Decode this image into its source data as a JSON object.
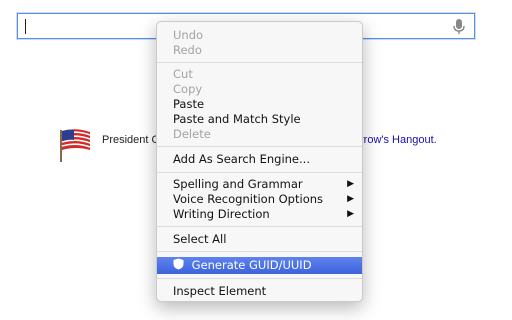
{
  "search": {
    "value": "",
    "icon": "mic-icon"
  },
  "faded_links": "··· ··· ··· ··· ··· ···",
  "doodle": {
    "flag_icon": "us-flag-icon",
    "text": "President O",
    "link": "rrow's Hangout."
  },
  "context_menu": {
    "undo": "Undo",
    "redo": "Redo",
    "cut": "Cut",
    "copy": "Copy",
    "paste": "Paste",
    "paste_match": "Paste and Match Style",
    "delete": "Delete",
    "add_search_engine": "Add As Search Engine...",
    "spelling": "Spelling and Grammar",
    "voice": "Voice Recognition Options",
    "writing_direction": "Writing Direction",
    "select_all": "Select All",
    "generate_guid": "Generate GUID/UUID",
    "inspect": "Inspect Element",
    "submenu_arrow": "▶"
  },
  "colors": {
    "highlight": "#3d63df",
    "disabled_text": "#a3a3a3",
    "link": "#1a0dab",
    "search_border": "#5b8fe0"
  }
}
